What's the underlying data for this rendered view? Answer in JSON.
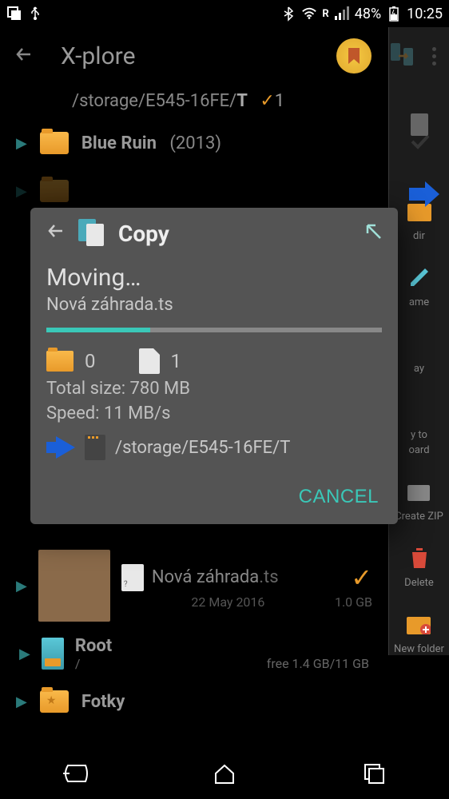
{
  "status": {
    "battery_pct": "48%",
    "time": "10:25",
    "roaming": "R"
  },
  "app": {
    "title": "X-plore",
    "path_prefix": "/storage/E545-16FE/",
    "path_bold": "T",
    "path_count": "1"
  },
  "files": {
    "blue_ruin": "Blue Ruin",
    "blue_ruin_year": "(2013)",
    "nova_name": "Nová záhrada",
    "nova_ext": ".ts",
    "nova_date": "22 May 2016",
    "nova_size": "1.0 GB",
    "root_name": "Root",
    "root_path": "/",
    "root_free": "free 1.4 GB/11 GB",
    "fotky": "Fotky"
  },
  "dialog": {
    "title": "Copy",
    "moving": "Moving…",
    "filename": "Nová záhrada.ts",
    "folder_count": "0",
    "file_count": "1",
    "total_size_label": "Total size:",
    "total_size_value": "780 MB",
    "speed_label": "Speed:",
    "speed_value": "11 MB/s",
    "dest_path": "/storage/E545-16FE/T",
    "cancel": "CANCEL"
  },
  "side": {
    "dir": "dir",
    "name": "ame",
    "ay": "ay",
    "yto": "y to",
    "oard": "oard",
    "create_zip": "Create ZIP",
    "delete": "Delete",
    "new_folder": "New folder"
  }
}
